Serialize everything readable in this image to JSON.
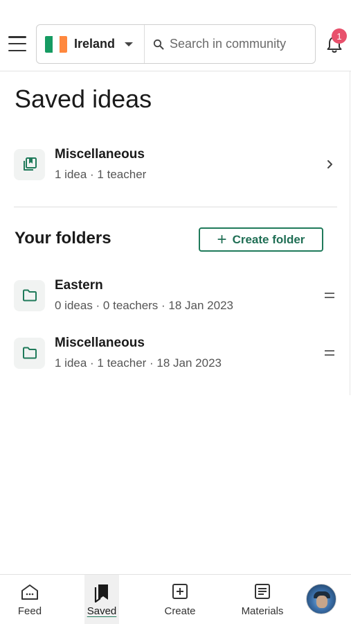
{
  "topbar": {
    "country": "Ireland",
    "search_placeholder": "Search in community",
    "notification_count": "1"
  },
  "page": {
    "title": "Saved ideas"
  },
  "collection": {
    "title": "Miscellaneous",
    "meta": "1 idea · 1 teacher"
  },
  "folders_section": {
    "title": "Your folders",
    "create_label": "Create folder"
  },
  "folders": [
    {
      "title": "Eastern",
      "meta": "0 ideas · 0 teachers · 18 Jan 2023"
    },
    {
      "title": "Miscellaneous",
      "meta": "1 idea · 1 teacher · 18 Jan 2023"
    }
  ],
  "bottom_nav": {
    "items": [
      {
        "label": "Feed",
        "icon": "home-icon"
      },
      {
        "label": "Saved",
        "icon": "bookmarks-icon",
        "active": true
      },
      {
        "label": "Create",
        "icon": "add-square-icon"
      },
      {
        "label": "Materials",
        "icon": "document-icon"
      },
      {
        "label": "",
        "icon": "avatar"
      }
    ]
  },
  "colors": {
    "accent": "#1f7a5a",
    "badge": "#e8516c",
    "flag_green": "#169b62",
    "flag_white": "#ffffff",
    "flag_orange": "#ff883e"
  }
}
